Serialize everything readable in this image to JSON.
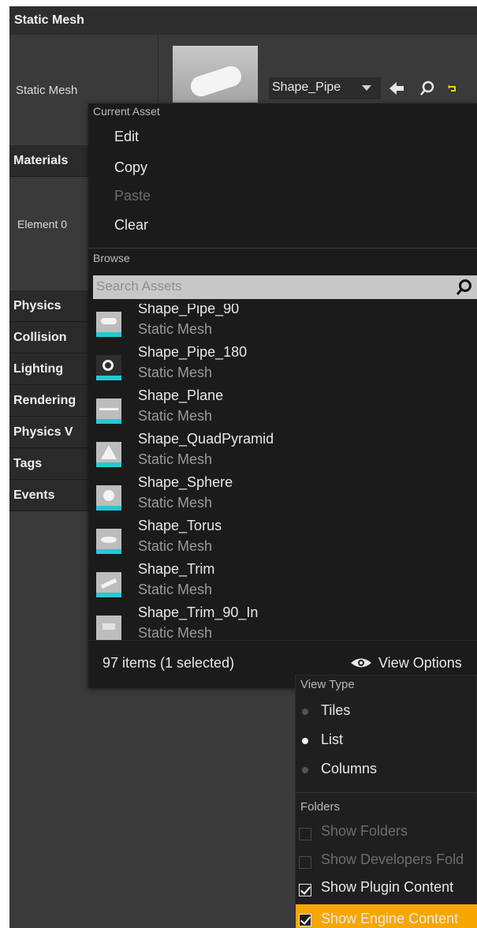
{
  "details": {
    "header": "Static Mesh",
    "static_mesh_label": "Static Mesh",
    "selected_mesh": "Shape_Pipe",
    "element_label": "Element 0",
    "categories": [
      "Materials",
      "Physics",
      "Collision",
      "Lighting",
      "Rendering",
      "Physics V",
      "Tags",
      "Events"
    ]
  },
  "menu": {
    "section_current_asset": "Current Asset",
    "edit": "Edit",
    "copy": "Copy",
    "paste": "Paste",
    "clear": "Clear",
    "section_browse": "Browse",
    "search_placeholder": "Search Assets",
    "assets": [
      {
        "name": "Shape_Pipe_90",
        "type": "Static Mesh"
      },
      {
        "name": "Shape_Pipe_180",
        "type": "Static Mesh"
      },
      {
        "name": "Shape_Plane",
        "type": "Static Mesh"
      },
      {
        "name": "Shape_QuadPyramid",
        "type": "Static Mesh"
      },
      {
        "name": "Shape_Sphere",
        "type": "Static Mesh"
      },
      {
        "name": "Shape_Torus",
        "type": "Static Mesh"
      },
      {
        "name": "Shape_Trim",
        "type": "Static Mesh"
      },
      {
        "name": "Shape_Trim_90_In",
        "type": "Static Mesh"
      }
    ],
    "item_count": "97 items (1 selected)",
    "view_options": "View Options"
  },
  "view_options": {
    "section_view_type": "View Type",
    "tiles": "Tiles",
    "list": "List",
    "columns": "Columns",
    "section_folders": "Folders",
    "show_folders": "Show Folders",
    "show_developers": "Show Developers Fold",
    "show_plugin": "Show Plugin Content",
    "show_engine": "Show Engine Content"
  },
  "colors": {
    "panel": "#3a3a3a",
    "menu": "#1b1b1b",
    "thumb_accent": "#25c9d3",
    "highlight": "#f5a700",
    "search_bg": "#c8c8c8"
  }
}
